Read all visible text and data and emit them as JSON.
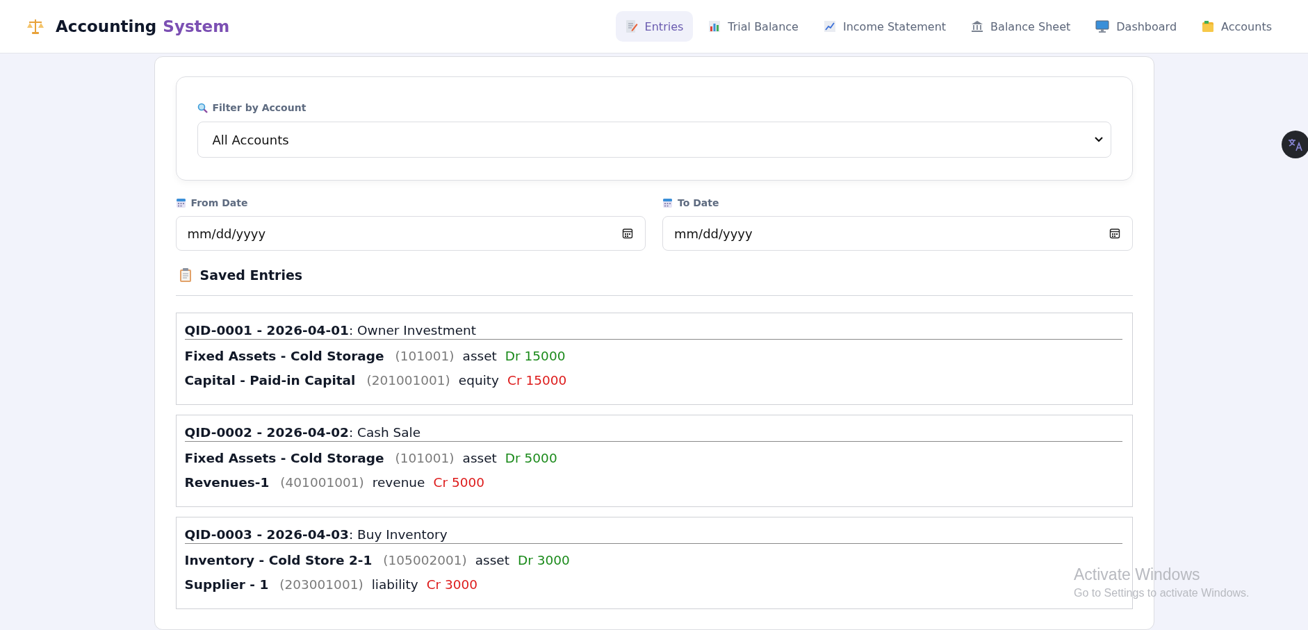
{
  "app": {
    "title_main": "Accounting",
    "title_accent": "System"
  },
  "nav": [
    {
      "label": "Entries",
      "selected": true
    },
    {
      "label": "Trial Balance",
      "selected": false
    },
    {
      "label": "Income Statement",
      "selected": false
    },
    {
      "label": "Balance Sheet",
      "selected": false
    },
    {
      "label": "Dashboard",
      "selected": false
    },
    {
      "label": "Accounts",
      "selected": false
    }
  ],
  "filter": {
    "label": "Filter by Account",
    "value": "All Accounts"
  },
  "dates": [
    {
      "label": "From Date",
      "placeholder": "mm/dd/yyyy"
    },
    {
      "label": "To Date",
      "placeholder": "mm/dd/yyyy"
    }
  ],
  "saved_title": "Saved Entries",
  "entries": [
    {
      "heading": "**QID-0001 - 2026-04-01**: Owner Investment",
      "lines": [
        {
          "account": "Fixed Assets - Cold Storage",
          "code": "(101001)",
          "type": "asset",
          "kind": "debit",
          "amount": "Dr 15000"
        },
        {
          "account": "Capital - Paid-in Capital",
          "code": "(201001001)",
          "type": "equity",
          "kind": "credit",
          "amount": "Cr 15000"
        }
      ]
    },
    {
      "heading": "**QID-0002 - 2026-04-02**: Cash Sale",
      "lines": [
        {
          "account": "Fixed Assets - Cold Storage",
          "code": "(101001)",
          "type": "asset",
          "kind": "debit",
          "amount": "Dr 5000"
        },
        {
          "account": "Revenues-1",
          "code": "(401001001)",
          "type": "revenue",
          "kind": "credit",
          "amount": "Cr 5000"
        }
      ]
    },
    {
      "heading": "**QID-0003 - 2026-04-03**: Buy Inventory",
      "lines": [
        {
          "account": "Inventory - Cold Store 2-1",
          "code": "(105002001)",
          "type": "asset",
          "kind": "debit",
          "amount": "Dr 3000"
        },
        {
          "account": "Supplier - 1",
          "code": "(203001001)",
          "type": "liability",
          "kind": "credit",
          "amount": "Cr 3000"
        }
      ]
    }
  ],
  "os_notice": {
    "title": "Activate Windows",
    "subtitle": "Go to Settings to activate Windows."
  }
}
